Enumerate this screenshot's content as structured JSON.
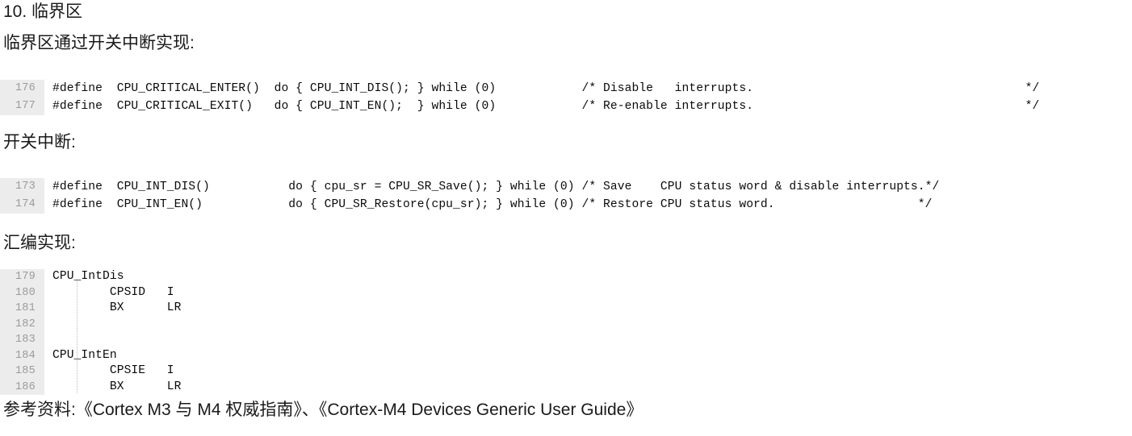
{
  "document": {
    "section_number": "10.",
    "title": "10. 临界区",
    "intro_paragraph": "临界区通过开关中断实现:",
    "switch_heading": "开关中断:",
    "asm_heading": "汇编实现:",
    "reference_line": "参考资料:《Cortex M3 与 M4 权威指南》、《Cortex-M4 Devices Generic User Guide》"
  },
  "colors": {
    "page_background": "#ffffff",
    "gutter_background": "#ececec",
    "line_number_text": "#9b9b9b",
    "code_text": "#0a0a0a",
    "prose_text": "#1a1a1a",
    "indent_guide": "#bdbdbd"
  },
  "code_blocks": [
    {
      "id": "code-critical",
      "language": "c",
      "rows": [
        {
          "number": "176",
          "text": "#define  CPU_CRITICAL_ENTER()  do { CPU_INT_DIS(); } while (0)            /* Disable   interrupts.                                      */"
        },
        {
          "number": "177",
          "text": "#define  CPU_CRITICAL_EXIT()   do { CPU_INT_EN();  } while (0)            /* Re-enable interrupts.                                      */"
        }
      ]
    },
    {
      "id": "code-int",
      "language": "c",
      "rows": [
        {
          "number": "173",
          "text": "#define  CPU_INT_DIS()           do { cpu_sr = CPU_SR_Save(); } while (0) /* Save    CPU status word & disable interrupts.*/"
        },
        {
          "number": "174",
          "text": "#define  CPU_INT_EN()            do { CPU_SR_Restore(cpu_sr); } while (0) /* Restore CPU status word.                    */"
        }
      ]
    },
    {
      "id": "code-asm",
      "language": "armasm",
      "rows": [
        {
          "number": "179",
          "text": "CPU_IntDis"
        },
        {
          "number": "180",
          "text": "        CPSID   I"
        },
        {
          "number": "181",
          "text": "        BX      LR"
        },
        {
          "number": "182",
          "text": ""
        },
        {
          "number": "183",
          "text": ""
        },
        {
          "number": "184",
          "text": "CPU_IntEn"
        },
        {
          "number": "185",
          "text": "        CPSIE   I"
        },
        {
          "number": "186",
          "text": "        BX      LR"
        }
      ]
    }
  ]
}
